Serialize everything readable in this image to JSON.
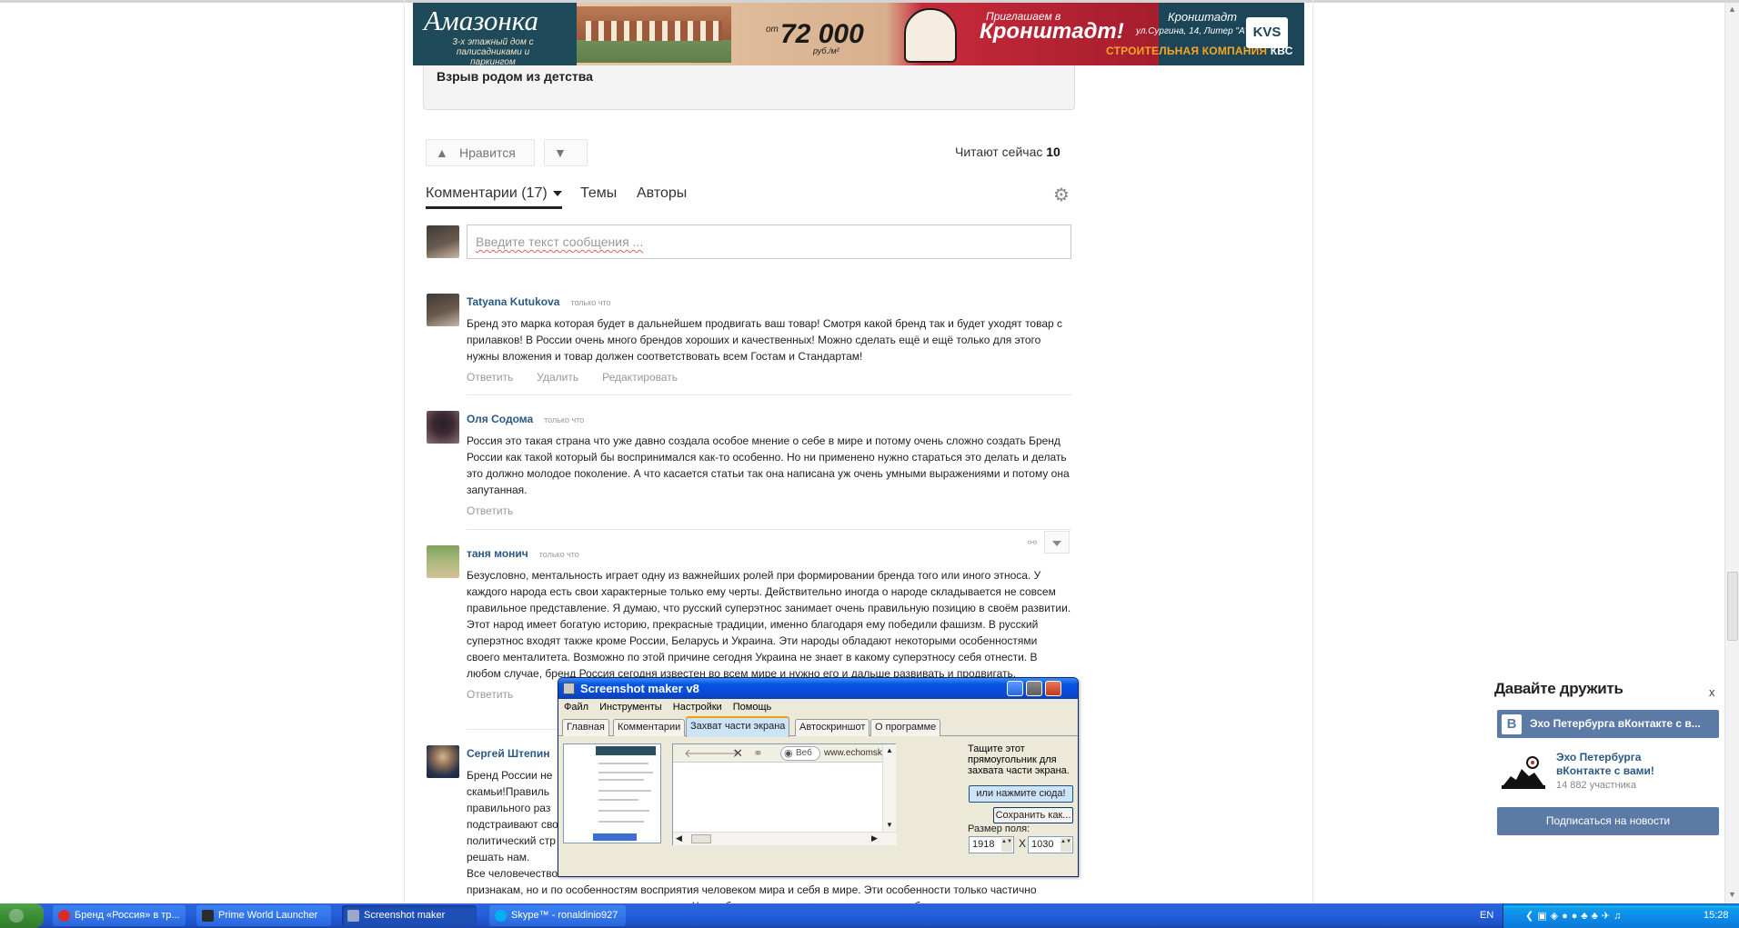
{
  "banner": {
    "brand": "Амазонка",
    "brand_sub": "3-х этажный дом с палисадниками и паркингом",
    "price_from": "от",
    "price": "72 000",
    "price_unit": "руб./м²",
    "invite_top": "Приглашаем в",
    "invite_main": "Кронштадт!",
    "city": "Кронштадт",
    "address": "ул.Сургина, 14, Литер \"А\"",
    "company_prefix": "СТРОИТЕЛЬНАЯ КОМПАНИЯ",
    "company_name": "КВС",
    "logo": "KVS"
  },
  "article": {
    "teaser_title": "Взрыв родом из детства"
  },
  "actions": {
    "like_label": "Нравится",
    "readers_label": "Читают сейчас",
    "readers_count": "10"
  },
  "tabs": {
    "comments_label": "Комментарии (17)",
    "topics_label": "Темы",
    "authors_label": "Авторы"
  },
  "comment_input": {
    "placeholder": "Введите текст сообщения ..."
  },
  "comments": [
    {
      "author": "Tatyana Kutukova",
      "time": "только что",
      "text": "Бренд это марка которая будет в дальнейшем продвигать ваш товар! Смотря какой бренд так и будет уходят товар с прилавков! В России очень много брендов хороших и качественных! Можно сделать ещё и ещё только для этого нужны вложения и товар должен соответствовать всем Гостам и Стандартам!",
      "reply": "Ответить",
      "delete": "Удалить",
      "edit": "Редактировать"
    },
    {
      "author": "Оля Содома",
      "time": "только что",
      "text": "Россия это такая страна что уже давно создала особое мнение о себе в мире и потому очень сложно создать Бренд России как такой который бы воспринимался как-то особенно. Но ни применено нужно стараться это делать и делать это должно молодое поколение. А что касается статьи так она написана уж очень умными выражениями и потому она запутанная.",
      "reply": "Ответить"
    },
    {
      "author": "таня монич",
      "time": "только что",
      "text": "Безусловно, ментальность играет одну из важнейших ролей при формировании бренда того или иного этноса. У каждого народа есть свои характерные только ему черты. Действительно иногда о народе складывается не совсем правильное представление. Я думаю, что русский суперэтнос занимает очень правильную позицию в своём развитии. Этот народ имеет богатую историю, прекрасные традиции, именно благодаря ему победили фашизм. В русский суперэтнос входят также кроме России, Беларусь и Украина. Эти народы обладают некоторыми особенностями своего менталитета. Возможно по этой причине сегодня Украина не знает в какому суперэтносу себя отнести. В любом случае, бренд Россия сегодня известен во всем мире и нужно его и дальше развивать и продвигать.",
      "reply": "Ответить"
    },
    {
      "author": "Сергей Штепин",
      "time": "",
      "lines": [
        "Бренд России не",
        "скамьи!Правиль",
        "правильного раз",
        "подстраивают сво",
        "политический стр",
        "решать нам.",
        "Все человечество"
      ],
      "tail1": "признакам, но и по особенностям восприятия человеком мира и себя в мире. Эти особенности только частично",
      "tail2": "зависят от воли человека и его воспитания. Через бессознательные механизмы эти особенности мировидения"
    }
  ],
  "vk_widget": {
    "heading": "Давайте дружить",
    "close": "x",
    "logo": "В",
    "group_bar": "Эхо Петербурга вКонтакте с в...",
    "group_name": "Эхо Петербурга вКонтакте с вами!",
    "members": "14 882 участника",
    "subscribe": "Подписаться на новости"
  },
  "screenshot_maker": {
    "title": "Screenshot maker v8",
    "menu": [
      "Файл",
      "Инструменты",
      "Настройки",
      "Помощь"
    ],
    "tabs": [
      "Главная",
      "Комментарии",
      "Захват части экрана",
      "Автоскриншот",
      "О программе"
    ],
    "web_label": "Веб",
    "url": "www.echomsk.s",
    "hint": "Тащите этот прямоугольник для захвата части экрана.",
    "click_here": "или нажмите сюда!",
    "save_as": "Сохранить как...",
    "size_label": "Размер поля:",
    "width": "1918",
    "height": "1030",
    "times": "X"
  },
  "taskbar": {
    "tasks": [
      {
        "label": "Бренд «Россия» в тр...",
        "icon_color": "#d82b2b"
      },
      {
        "label": "Prime World Launcher",
        "icon_color": "#2b2b2b"
      },
      {
        "label": "Screenshot maker",
        "icon_color": "#9aa9c7"
      },
      {
        "label": "Skype™ - ronaldinio927",
        "icon_color": "#00aff0"
      }
    ],
    "lang": "EN",
    "clock": "15:28"
  }
}
